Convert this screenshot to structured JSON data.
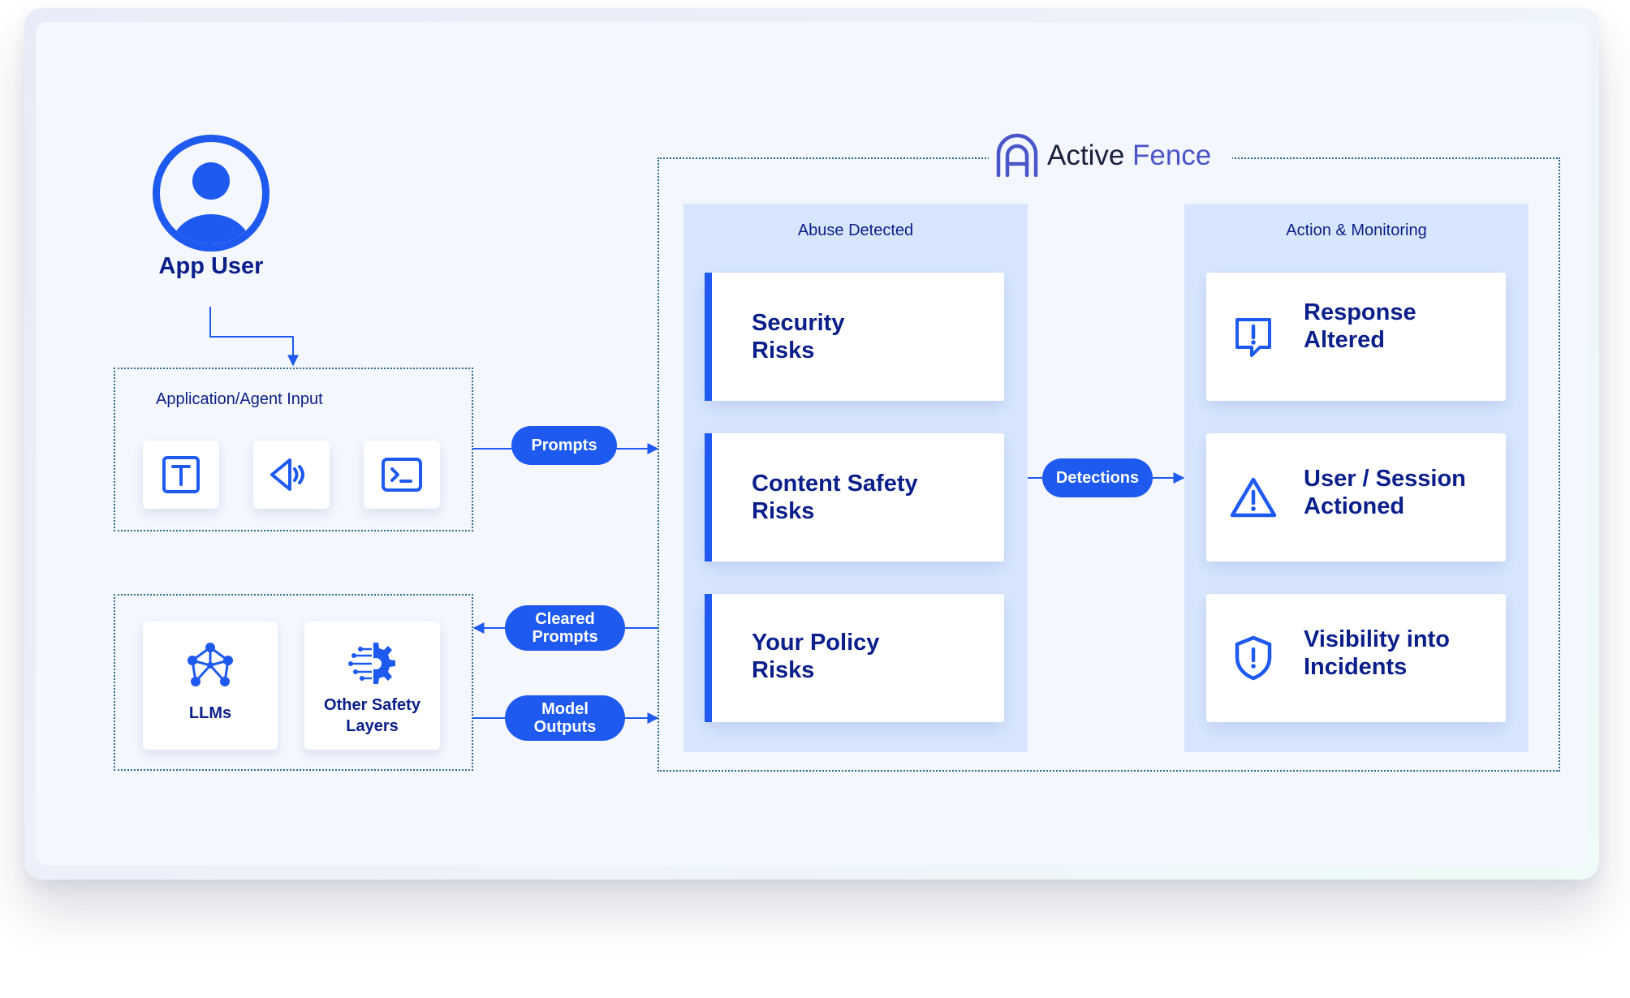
{
  "app_user": {
    "label": "App User"
  },
  "input_group": {
    "label": "Application/Agent Input"
  },
  "models_group": {
    "llms_label": "LLMs",
    "other_layers_line1": "Other Safety",
    "other_layers_line2": "Layers"
  },
  "flows": {
    "prompts": "Prompts",
    "cleared_line1": "Cleared",
    "cleared_line2": "Prompts",
    "outputs_line1": "Model",
    "outputs_line2": "Outputs",
    "detections": "Detections"
  },
  "brand": {
    "part1": "Active",
    "part2": "Fence"
  },
  "abuse_column": {
    "title": "Abuse Detected",
    "items": [
      {
        "line1": "Security",
        "line2": "Risks"
      },
      {
        "line1": "Content Safety",
        "line2": "Risks"
      },
      {
        "line1": "Your Policy",
        "line2": "Risks"
      }
    ]
  },
  "action_column": {
    "title": "Action & Monitoring",
    "items": [
      {
        "line1": "Response",
        "line2": "Altered",
        "icon": "message-alert-icon"
      },
      {
        "line1": "User / Session",
        "line2": "Actioned",
        "icon": "warning-triangle-icon"
      },
      {
        "line1": "Visibility into",
        "line2": "Incidents",
        "icon": "shield-alert-icon"
      }
    ]
  },
  "colors": {
    "accent": "#1e5af0",
    "text": "#0b1f8a",
    "panel": "#d8e6fd",
    "background": "#f4f7fe"
  }
}
